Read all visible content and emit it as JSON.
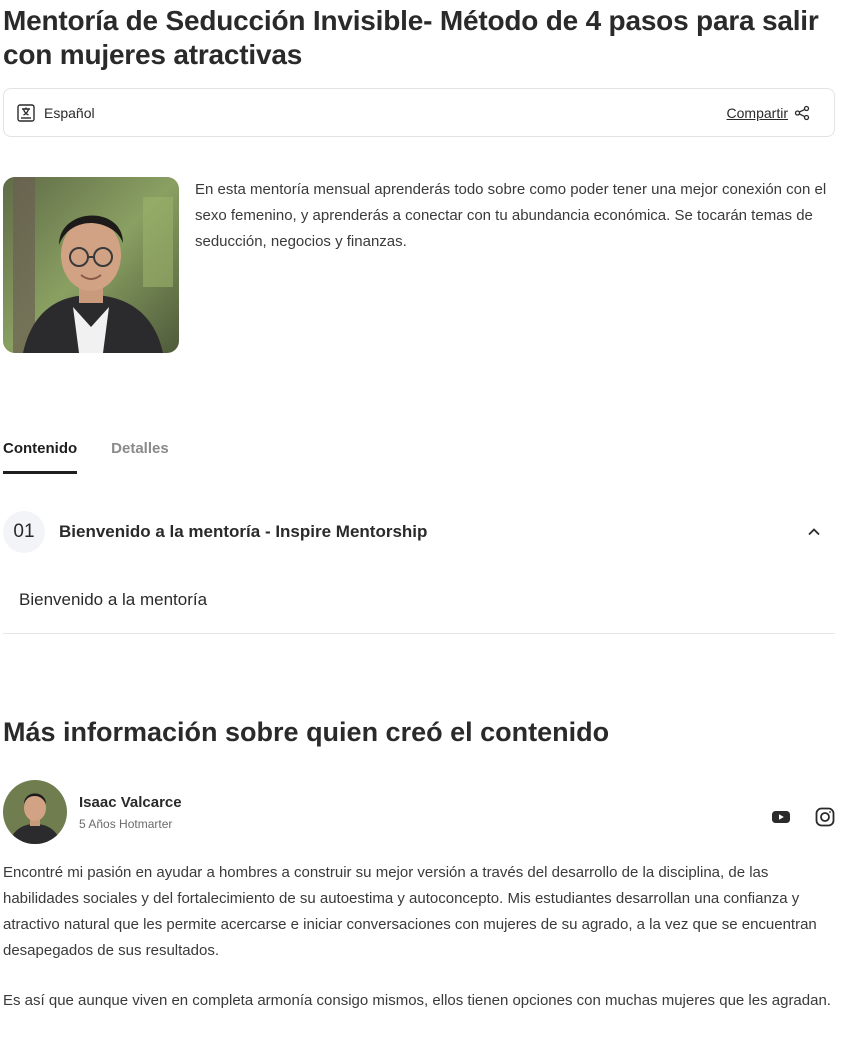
{
  "title": "Mentoría de Seducción Invisible- Método de 4 pasos para salir con mujeres atractivas",
  "toolbar": {
    "language": "Español",
    "share_label": "Compartir"
  },
  "hero": {
    "description": "En esta mentoría mensual aprenderás todo sobre como poder tener una mejor conexión con el sexo femenino, y aprenderás a conectar con tu abundancia económica. Se tocarán temas de seducción, negocios y finanzas."
  },
  "tabs": [
    {
      "label": "Contenido",
      "active": true
    },
    {
      "label": "Detalles",
      "active": false
    }
  ],
  "modules": [
    {
      "number": "01",
      "title": "Bienvenido a la mentoría - Inspire Mentorship",
      "lessons": [
        "Bienvenido a la mentoría"
      ]
    }
  ],
  "author_section": {
    "title": "Más información sobre quien creó el contenido",
    "name": "Isaac Valcarce",
    "meta": "5 Años Hotmarter",
    "bio": [
      "Encontré mi pasión en ayudar a hombres a construir su mejor versión a través del desarrollo de la disciplina, de las habilidades sociales y del fortalecimiento de su autoestima y autoconcepto. Mis estudiantes desarrollan una confianza y atractivo natural que les permite acercarse e iniciar conversaciones con mujeres de su agrado, a la vez que se encuentran desapegados de sus resultados.",
      "Es así que aunque viven en completa armonía consigo mismos, ellos tienen opciones con muchas mujeres que les agradan."
    ],
    "social": [
      "youtube-icon",
      "instagram-icon"
    ]
  }
}
